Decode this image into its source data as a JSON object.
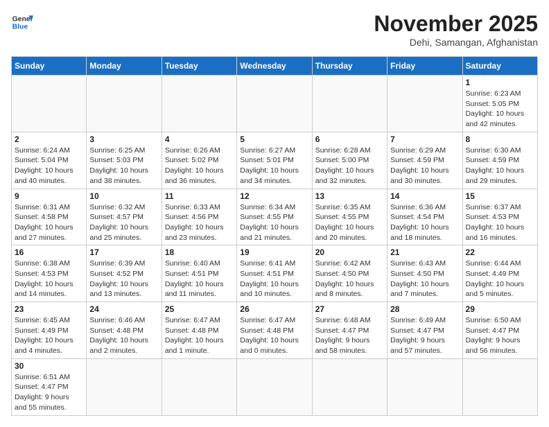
{
  "header": {
    "logo_line1": "General",
    "logo_line2": "Blue",
    "month": "November 2025",
    "location": "Dehi, Samangan, Afghanistan"
  },
  "weekdays": [
    "Sunday",
    "Monday",
    "Tuesday",
    "Wednesday",
    "Thursday",
    "Friday",
    "Saturday"
  ],
  "weeks": [
    [
      {
        "day": "",
        "info": ""
      },
      {
        "day": "",
        "info": ""
      },
      {
        "day": "",
        "info": ""
      },
      {
        "day": "",
        "info": ""
      },
      {
        "day": "",
        "info": ""
      },
      {
        "day": "",
        "info": ""
      },
      {
        "day": "1",
        "info": "Sunrise: 6:23 AM\nSunset: 5:05 PM\nDaylight: 10 hours\nand 42 minutes."
      }
    ],
    [
      {
        "day": "2",
        "info": "Sunrise: 6:24 AM\nSunset: 5:04 PM\nDaylight: 10 hours\nand 40 minutes."
      },
      {
        "day": "3",
        "info": "Sunrise: 6:25 AM\nSunset: 5:03 PM\nDaylight: 10 hours\nand 38 minutes."
      },
      {
        "day": "4",
        "info": "Sunrise: 6:26 AM\nSunset: 5:02 PM\nDaylight: 10 hours\nand 36 minutes."
      },
      {
        "day": "5",
        "info": "Sunrise: 6:27 AM\nSunset: 5:01 PM\nDaylight: 10 hours\nand 34 minutes."
      },
      {
        "day": "6",
        "info": "Sunrise: 6:28 AM\nSunset: 5:00 PM\nDaylight: 10 hours\nand 32 minutes."
      },
      {
        "day": "7",
        "info": "Sunrise: 6:29 AM\nSunset: 4:59 PM\nDaylight: 10 hours\nand 30 minutes."
      },
      {
        "day": "8",
        "info": "Sunrise: 6:30 AM\nSunset: 4:59 PM\nDaylight: 10 hours\nand 29 minutes."
      }
    ],
    [
      {
        "day": "9",
        "info": "Sunrise: 6:31 AM\nSunset: 4:58 PM\nDaylight: 10 hours\nand 27 minutes."
      },
      {
        "day": "10",
        "info": "Sunrise: 6:32 AM\nSunset: 4:57 PM\nDaylight: 10 hours\nand 25 minutes."
      },
      {
        "day": "11",
        "info": "Sunrise: 6:33 AM\nSunset: 4:56 PM\nDaylight: 10 hours\nand 23 minutes."
      },
      {
        "day": "12",
        "info": "Sunrise: 6:34 AM\nSunset: 4:55 PM\nDaylight: 10 hours\nand 21 minutes."
      },
      {
        "day": "13",
        "info": "Sunrise: 6:35 AM\nSunset: 4:55 PM\nDaylight: 10 hours\nand 20 minutes."
      },
      {
        "day": "14",
        "info": "Sunrise: 6:36 AM\nSunset: 4:54 PM\nDaylight: 10 hours\nand 18 minutes."
      },
      {
        "day": "15",
        "info": "Sunrise: 6:37 AM\nSunset: 4:53 PM\nDaylight: 10 hours\nand 16 minutes."
      }
    ],
    [
      {
        "day": "16",
        "info": "Sunrise: 6:38 AM\nSunset: 4:53 PM\nDaylight: 10 hours\nand 14 minutes."
      },
      {
        "day": "17",
        "info": "Sunrise: 6:39 AM\nSunset: 4:52 PM\nDaylight: 10 hours\nand 13 minutes."
      },
      {
        "day": "18",
        "info": "Sunrise: 6:40 AM\nSunset: 4:51 PM\nDaylight: 10 hours\nand 11 minutes."
      },
      {
        "day": "19",
        "info": "Sunrise: 6:41 AM\nSunset: 4:51 PM\nDaylight: 10 hours\nand 10 minutes."
      },
      {
        "day": "20",
        "info": "Sunrise: 6:42 AM\nSunset: 4:50 PM\nDaylight: 10 hours\nand 8 minutes."
      },
      {
        "day": "21",
        "info": "Sunrise: 6:43 AM\nSunset: 4:50 PM\nDaylight: 10 hours\nand 7 minutes."
      },
      {
        "day": "22",
        "info": "Sunrise: 6:44 AM\nSunset: 4:49 PM\nDaylight: 10 hours\nand 5 minutes."
      }
    ],
    [
      {
        "day": "23",
        "info": "Sunrise: 6:45 AM\nSunset: 4:49 PM\nDaylight: 10 hours\nand 4 minutes."
      },
      {
        "day": "24",
        "info": "Sunrise: 6:46 AM\nSunset: 4:48 PM\nDaylight: 10 hours\nand 2 minutes."
      },
      {
        "day": "25",
        "info": "Sunrise: 6:47 AM\nSunset: 4:48 PM\nDaylight: 10 hours\nand 1 minute."
      },
      {
        "day": "26",
        "info": "Sunrise: 6:47 AM\nSunset: 4:48 PM\nDaylight: 10 hours\nand 0 minutes."
      },
      {
        "day": "27",
        "info": "Sunrise: 6:48 AM\nSunset: 4:47 PM\nDaylight: 9 hours\nand 58 minutes."
      },
      {
        "day": "28",
        "info": "Sunrise: 6:49 AM\nSunset: 4:47 PM\nDaylight: 9 hours\nand 57 minutes."
      },
      {
        "day": "29",
        "info": "Sunrise: 6:50 AM\nSunset: 4:47 PM\nDaylight: 9 hours\nand 56 minutes."
      }
    ],
    [
      {
        "day": "30",
        "info": "Sunrise: 6:51 AM\nSunset: 4:47 PM\nDaylight: 9 hours\nand 55 minutes."
      },
      {
        "day": "",
        "info": ""
      },
      {
        "day": "",
        "info": ""
      },
      {
        "day": "",
        "info": ""
      },
      {
        "day": "",
        "info": ""
      },
      {
        "day": "",
        "info": ""
      },
      {
        "day": "",
        "info": ""
      }
    ]
  ]
}
